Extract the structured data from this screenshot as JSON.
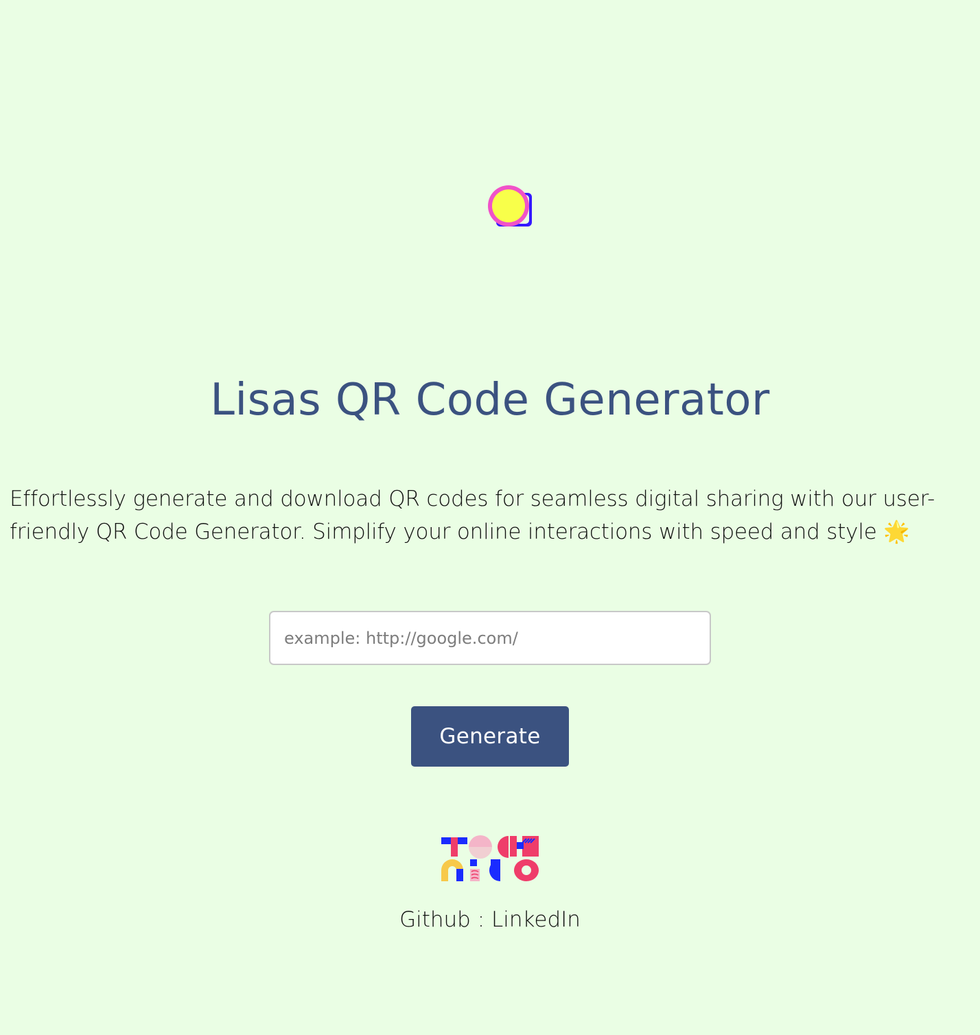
{
  "header": {
    "logo_icon": "yellow-circle-icon",
    "title": "Lisas QR Code Generator"
  },
  "main": {
    "tagline": "Effortlessly generate and download QR codes for seamless digital sharing with our user-friendly QR Code Generator. Simplify your online interactions with speed and style",
    "tagline_emoji": "🌟",
    "url_input": {
      "placeholder": "example: http://google.com/",
      "value": ""
    },
    "generate_label": "Generate"
  },
  "footer": {
    "brand_logo_text": "tech nico",
    "github_label": "Github",
    "separator": " : ",
    "linkedin_label": "LinkedIn"
  },
  "colors": {
    "background": "#eafee4",
    "accent": "#3b5280",
    "logo_yellow": "#f8ff4a",
    "logo_pink": "#f052c8",
    "logo_blue": "#3418ff"
  }
}
